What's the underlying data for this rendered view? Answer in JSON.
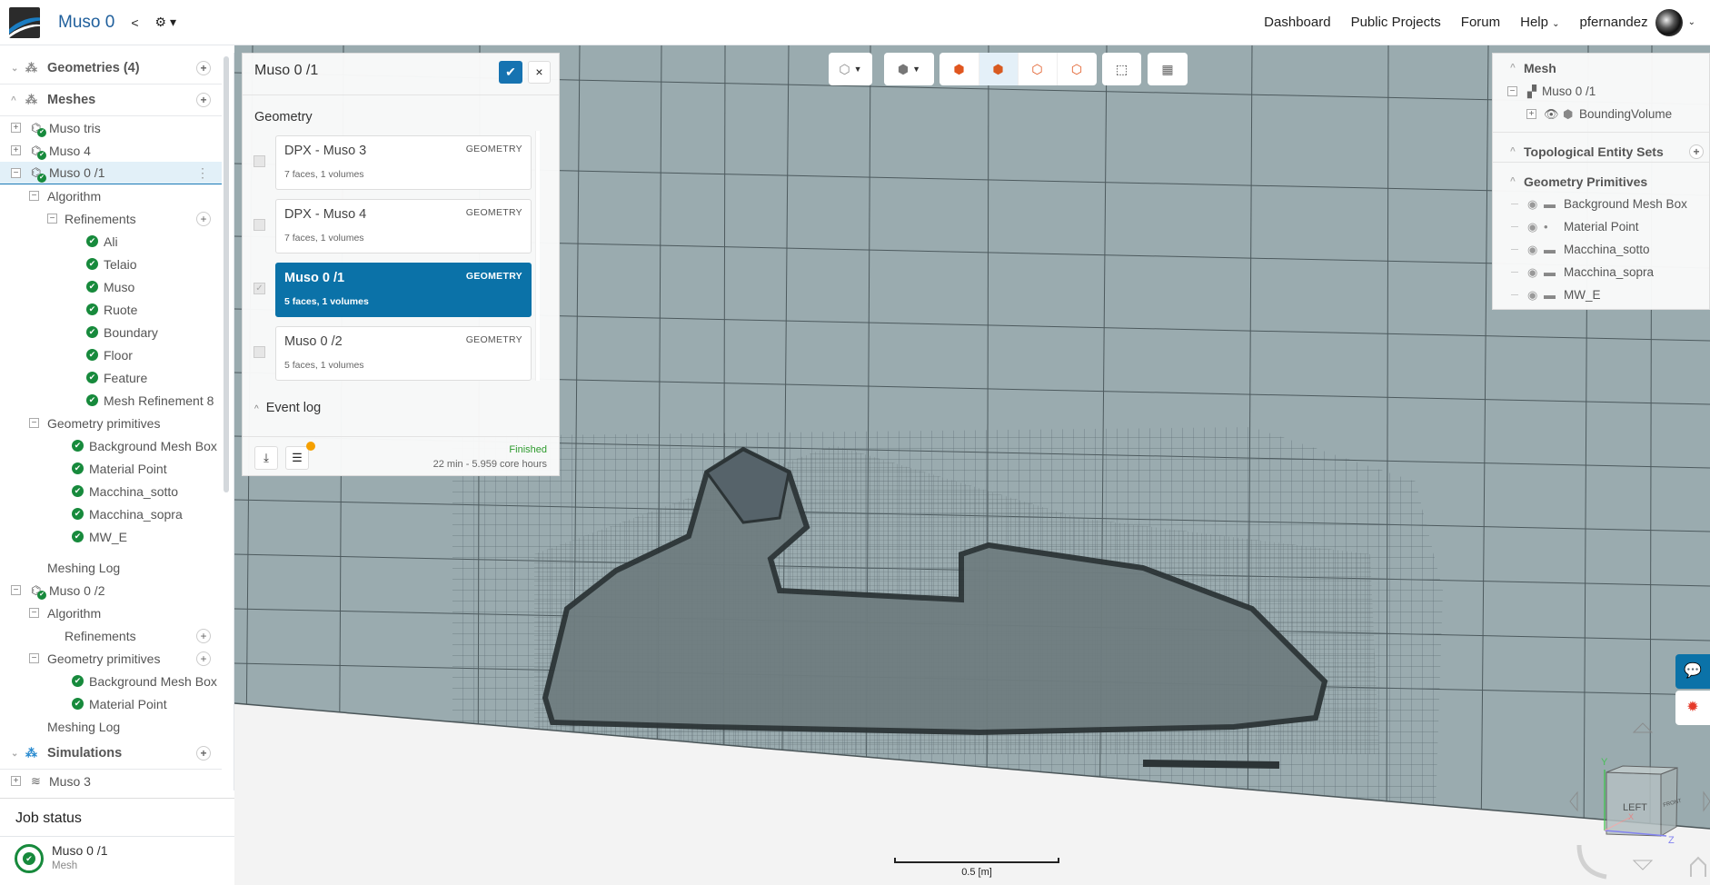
{
  "header": {
    "project_title": "Muso 0",
    "nav": [
      "Dashboard",
      "Public Projects",
      "Forum",
      "Help"
    ],
    "username": "pfernandez"
  },
  "sidebar": {
    "rows": [
      {
        "label": "Geometries (4)",
        "type": "section",
        "icon": "geometries-icon",
        "plus": true
      },
      {
        "label": "Meshes",
        "type": "section",
        "icon": "meshes-icon",
        "plus": true,
        "open": true
      },
      {
        "label": "Muso tris",
        "type": "mesh",
        "depth": 0,
        "exp": "+"
      },
      {
        "label": "Muso 4",
        "type": "mesh",
        "depth": 0,
        "exp": "+"
      },
      {
        "label": "Muso 0 /1",
        "type": "mesh",
        "depth": 0,
        "exp": "−",
        "selected": true
      },
      {
        "label": "Algorithm",
        "type": "node",
        "depth": 1,
        "exp": "−"
      },
      {
        "label": "Refinements",
        "type": "node",
        "depth": 2,
        "exp": "−",
        "plus": true
      },
      {
        "label": "Ali",
        "type": "check",
        "depth": 3
      },
      {
        "label": "Telaio",
        "type": "check",
        "depth": 3
      },
      {
        "label": "Muso",
        "type": "check",
        "depth": 3
      },
      {
        "label": "Ruote",
        "type": "check",
        "depth": 3
      },
      {
        "label": "Boundary",
        "type": "check",
        "depth": 3
      },
      {
        "label": "Floor",
        "type": "check",
        "depth": 3
      },
      {
        "label": "Feature",
        "type": "check",
        "depth": 3
      },
      {
        "label": "Mesh Refinement 8",
        "type": "check",
        "depth": 3
      },
      {
        "label": "Geometry primitives",
        "type": "node",
        "depth": 1,
        "exp": "−"
      },
      {
        "label": "Background Mesh Box",
        "type": "check",
        "depth": 2
      },
      {
        "label": "Material Point",
        "type": "check",
        "depth": 2
      },
      {
        "label": "Macchina_sotto",
        "type": "check",
        "depth": 2
      },
      {
        "label": "Macchina_sopra",
        "type": "check",
        "depth": 2
      },
      {
        "label": "MW_E",
        "type": "check",
        "depth": 2
      },
      {
        "label": "Meshing Log",
        "type": "node",
        "depth": 1,
        "gap": true
      },
      {
        "label": "Muso 0 /2",
        "type": "mesh",
        "depth": 0,
        "exp": "−"
      },
      {
        "label": "Algorithm",
        "type": "node",
        "depth": 1,
        "exp": "−"
      },
      {
        "label": "Refinements",
        "type": "node",
        "depth": 2,
        "plus": true
      },
      {
        "label": "Geometry primitives",
        "type": "node",
        "depth": 1,
        "exp": "−",
        "plus": true
      },
      {
        "label": "Background Mesh Box",
        "type": "check",
        "depth": 2
      },
      {
        "label": "Material Point",
        "type": "check",
        "depth": 2
      },
      {
        "label": "Meshing Log",
        "type": "node",
        "depth": 1
      },
      {
        "label": "Simulations",
        "type": "section",
        "icon": "simulations-icon",
        "plus": true
      },
      {
        "label": "Muso 3",
        "type": "sim",
        "depth": 0,
        "exp": "+"
      }
    ]
  },
  "job_status": {
    "title": "Job status",
    "job_name": "Muso 0 /1",
    "job_type": "Mesh"
  },
  "panel": {
    "title": "Muso 0 /1",
    "section": "Geometry",
    "cards": [
      {
        "name": "DPX - Muso 3",
        "tag": "GEOMETRY",
        "info": "7 faces, 1 volumes",
        "checked": false
      },
      {
        "name": "DPX - Muso 4",
        "tag": "GEOMETRY",
        "info": "7 faces, 1 volumes",
        "checked": false
      },
      {
        "name": "Muso 0 /1",
        "tag": "GEOMETRY",
        "info": "5 faces, 1 volumes",
        "checked": true,
        "active": true
      },
      {
        "name": "Muso 0 /2",
        "tag": "GEOMETRY",
        "info": "5 faces, 1 volumes",
        "checked": false
      }
    ],
    "event_log": "Event log",
    "status": "Finished",
    "duration": "22 min - 5.959 core hours"
  },
  "right_panel": {
    "mesh_title": "Mesh",
    "mesh_item": "Muso 0 /1",
    "bounding": "BoundingVolume",
    "tes_title": "Topological Entity Sets",
    "gp_title": "Geometry Primitives",
    "primitives": [
      "Background Mesh Box",
      "Material Point",
      "Macchina_sotto",
      "Macchina_sopra",
      "MW_E"
    ]
  },
  "viewport": {
    "scale_label": "0.5 [m]",
    "cube_face": "LEFT",
    "cube_side": "FRONT",
    "axes": [
      "Y",
      "X",
      "Z"
    ]
  },
  "colors": {
    "accent": "#1673b1",
    "success": "#178a3c",
    "mesh_bg": "#9aabaf",
    "notify": "#f5a000",
    "bug": "#e53a2a"
  }
}
